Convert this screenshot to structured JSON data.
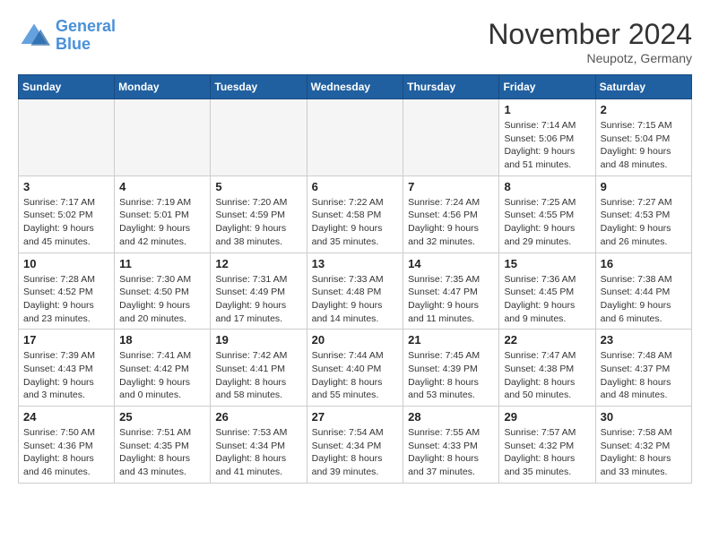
{
  "header": {
    "logo_line1": "General",
    "logo_line2": "Blue",
    "month": "November 2024",
    "location": "Neupotz, Germany"
  },
  "weekdays": [
    "Sunday",
    "Monday",
    "Tuesday",
    "Wednesday",
    "Thursday",
    "Friday",
    "Saturday"
  ],
  "weeks": [
    [
      {
        "day": "",
        "info": ""
      },
      {
        "day": "",
        "info": ""
      },
      {
        "day": "",
        "info": ""
      },
      {
        "day": "",
        "info": ""
      },
      {
        "day": "",
        "info": ""
      },
      {
        "day": "1",
        "info": "Sunrise: 7:14 AM\nSunset: 5:06 PM\nDaylight: 9 hours\nand 51 minutes."
      },
      {
        "day": "2",
        "info": "Sunrise: 7:15 AM\nSunset: 5:04 PM\nDaylight: 9 hours\nand 48 minutes."
      }
    ],
    [
      {
        "day": "3",
        "info": "Sunrise: 7:17 AM\nSunset: 5:02 PM\nDaylight: 9 hours\nand 45 minutes."
      },
      {
        "day": "4",
        "info": "Sunrise: 7:19 AM\nSunset: 5:01 PM\nDaylight: 9 hours\nand 42 minutes."
      },
      {
        "day": "5",
        "info": "Sunrise: 7:20 AM\nSunset: 4:59 PM\nDaylight: 9 hours\nand 38 minutes."
      },
      {
        "day": "6",
        "info": "Sunrise: 7:22 AM\nSunset: 4:58 PM\nDaylight: 9 hours\nand 35 minutes."
      },
      {
        "day": "7",
        "info": "Sunrise: 7:24 AM\nSunset: 4:56 PM\nDaylight: 9 hours\nand 32 minutes."
      },
      {
        "day": "8",
        "info": "Sunrise: 7:25 AM\nSunset: 4:55 PM\nDaylight: 9 hours\nand 29 minutes."
      },
      {
        "day": "9",
        "info": "Sunrise: 7:27 AM\nSunset: 4:53 PM\nDaylight: 9 hours\nand 26 minutes."
      }
    ],
    [
      {
        "day": "10",
        "info": "Sunrise: 7:28 AM\nSunset: 4:52 PM\nDaylight: 9 hours\nand 23 minutes."
      },
      {
        "day": "11",
        "info": "Sunrise: 7:30 AM\nSunset: 4:50 PM\nDaylight: 9 hours\nand 20 minutes."
      },
      {
        "day": "12",
        "info": "Sunrise: 7:31 AM\nSunset: 4:49 PM\nDaylight: 9 hours\nand 17 minutes."
      },
      {
        "day": "13",
        "info": "Sunrise: 7:33 AM\nSunset: 4:48 PM\nDaylight: 9 hours\nand 14 minutes."
      },
      {
        "day": "14",
        "info": "Sunrise: 7:35 AM\nSunset: 4:47 PM\nDaylight: 9 hours\nand 11 minutes."
      },
      {
        "day": "15",
        "info": "Sunrise: 7:36 AM\nSunset: 4:45 PM\nDaylight: 9 hours\nand 9 minutes."
      },
      {
        "day": "16",
        "info": "Sunrise: 7:38 AM\nSunset: 4:44 PM\nDaylight: 9 hours\nand 6 minutes."
      }
    ],
    [
      {
        "day": "17",
        "info": "Sunrise: 7:39 AM\nSunset: 4:43 PM\nDaylight: 9 hours\nand 3 minutes."
      },
      {
        "day": "18",
        "info": "Sunrise: 7:41 AM\nSunset: 4:42 PM\nDaylight: 9 hours\nand 0 minutes."
      },
      {
        "day": "19",
        "info": "Sunrise: 7:42 AM\nSunset: 4:41 PM\nDaylight: 8 hours\nand 58 minutes."
      },
      {
        "day": "20",
        "info": "Sunrise: 7:44 AM\nSunset: 4:40 PM\nDaylight: 8 hours\nand 55 minutes."
      },
      {
        "day": "21",
        "info": "Sunrise: 7:45 AM\nSunset: 4:39 PM\nDaylight: 8 hours\nand 53 minutes."
      },
      {
        "day": "22",
        "info": "Sunrise: 7:47 AM\nSunset: 4:38 PM\nDaylight: 8 hours\nand 50 minutes."
      },
      {
        "day": "23",
        "info": "Sunrise: 7:48 AM\nSunset: 4:37 PM\nDaylight: 8 hours\nand 48 minutes."
      }
    ],
    [
      {
        "day": "24",
        "info": "Sunrise: 7:50 AM\nSunset: 4:36 PM\nDaylight: 8 hours\nand 46 minutes."
      },
      {
        "day": "25",
        "info": "Sunrise: 7:51 AM\nSunset: 4:35 PM\nDaylight: 8 hours\nand 43 minutes."
      },
      {
        "day": "26",
        "info": "Sunrise: 7:53 AM\nSunset: 4:34 PM\nDaylight: 8 hours\nand 41 minutes."
      },
      {
        "day": "27",
        "info": "Sunrise: 7:54 AM\nSunset: 4:34 PM\nDaylight: 8 hours\nand 39 minutes."
      },
      {
        "day": "28",
        "info": "Sunrise: 7:55 AM\nSunset: 4:33 PM\nDaylight: 8 hours\nand 37 minutes."
      },
      {
        "day": "29",
        "info": "Sunrise: 7:57 AM\nSunset: 4:32 PM\nDaylight: 8 hours\nand 35 minutes."
      },
      {
        "day": "30",
        "info": "Sunrise: 7:58 AM\nSunset: 4:32 PM\nDaylight: 8 hours\nand 33 minutes."
      }
    ]
  ]
}
